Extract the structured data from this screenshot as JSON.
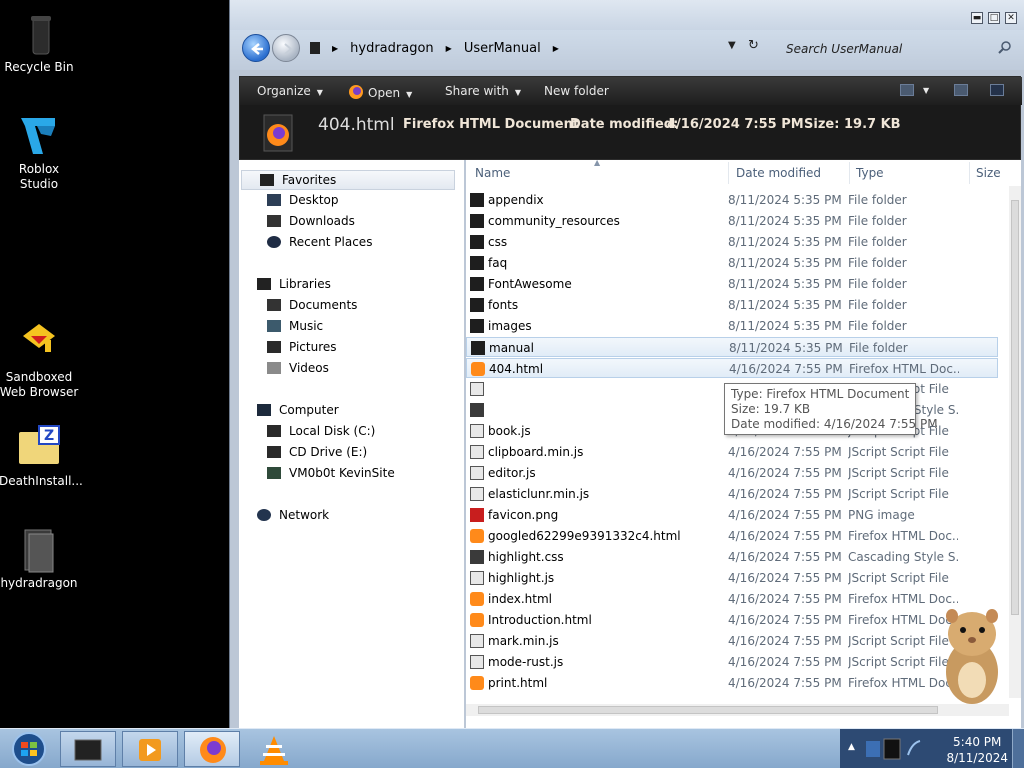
{
  "desktop": {
    "icons": [
      {
        "label": "Recycle Bin",
        "icon": "recycle-bin-icon"
      },
      {
        "label": "Roblox Studio",
        "icon": "roblox-studio-icon"
      },
      {
        "label": "Sandboxed Web Browser",
        "icon": "sandboxie-icon"
      },
      {
        "label": "DeathInstall...",
        "icon": "zip-folder-icon"
      },
      {
        "label": "hydradragon",
        "icon": "user-folder-icon"
      }
    ]
  },
  "window": {
    "controls": {
      "minimize": "▬",
      "maximize": "□",
      "close": "✕"
    },
    "breadcrumb": [
      "hydradragon",
      "UserManual"
    ],
    "search_placeholder": "Search UserManual",
    "toolbar": {
      "organize": "Organize",
      "open": "Open",
      "share_with": "Share with",
      "new_folder": "New folder"
    },
    "details": {
      "file_name": "404.html",
      "file_type": "Firefox HTML Document",
      "date_label": "Date modified:",
      "date_value": "4/16/2024 7:55 PM",
      "size_label": "Size:",
      "size_value": "19.7 KB"
    },
    "nav": {
      "favorites": "Favorites",
      "desktop": "Desktop",
      "downloads": "Downloads",
      "recent_places": "Recent Places",
      "libraries": "Libraries",
      "documents": "Documents",
      "music": "Music",
      "pictures": "Pictures",
      "videos": "Videos",
      "computer": "Computer",
      "local_disk": "Local Disk (C:)",
      "cd_drive": "CD Drive (E:)",
      "vm": "VM0b0t KevinSite",
      "network": "Network"
    },
    "columns": {
      "name": "Name",
      "date": "Date modified",
      "type": "Type",
      "size": "Size"
    },
    "files": [
      {
        "name": "appendix",
        "date": "8/11/2024 5:35 PM",
        "type": "File folder",
        "kind": "folder"
      },
      {
        "name": "community_resources",
        "date": "8/11/2024 5:35 PM",
        "type": "File folder",
        "kind": "folder"
      },
      {
        "name": "css",
        "date": "8/11/2024 5:35 PM",
        "type": "File folder",
        "kind": "folder"
      },
      {
        "name": "faq",
        "date": "8/11/2024 5:35 PM",
        "type": "File folder",
        "kind": "folder"
      },
      {
        "name": "FontAwesome",
        "date": "8/11/2024 5:35 PM",
        "type": "File folder",
        "kind": "folder"
      },
      {
        "name": "fonts",
        "date": "8/11/2024 5:35 PM",
        "type": "File folder",
        "kind": "folder"
      },
      {
        "name": "images",
        "date": "8/11/2024 5:35 PM",
        "type": "File folder",
        "kind": "folder"
      },
      {
        "name": "manual",
        "date": "8/11/2024 5:35 PM",
        "type": "File folder",
        "kind": "folder"
      },
      {
        "name": "404.html",
        "date": "4/16/2024 7:55 PM",
        "type": "Firefox HTML Doc...",
        "kind": "html"
      },
      {
        "name": "",
        "date": "4/16/2024 7:55 PM",
        "type": "JScript Script File",
        "kind": "js"
      },
      {
        "name": "",
        "date": "4/16/2024 7:55 PM",
        "type": "Cascading Style S...",
        "kind": "css"
      },
      {
        "name": "book.js",
        "date": "4/16/2024 7:55 PM",
        "type": "JScript Script File",
        "kind": "js"
      },
      {
        "name": "clipboard.min.js",
        "date": "4/16/2024 7:55 PM",
        "type": "JScript Script File",
        "kind": "js"
      },
      {
        "name": "editor.js",
        "date": "4/16/2024 7:55 PM",
        "type": "JScript Script File",
        "kind": "js"
      },
      {
        "name": "elasticlunr.min.js",
        "date": "4/16/2024 7:55 PM",
        "type": "JScript Script File",
        "kind": "js"
      },
      {
        "name": "favicon.png",
        "date": "4/16/2024 7:55 PM",
        "type": "PNG image",
        "kind": "png"
      },
      {
        "name": "googled62299e9391332c4.html",
        "date": "4/16/2024 7:55 PM",
        "type": "Firefox HTML Doc...",
        "kind": "html"
      },
      {
        "name": "highlight.css",
        "date": "4/16/2024 7:55 PM",
        "type": "Cascading Style S...",
        "kind": "css"
      },
      {
        "name": "highlight.js",
        "date": "4/16/2024 7:55 PM",
        "type": "JScript Script File",
        "kind": "js"
      },
      {
        "name": "index.html",
        "date": "4/16/2024 7:55 PM",
        "type": "Firefox HTML Doc...",
        "kind": "html"
      },
      {
        "name": "Introduction.html",
        "date": "4/16/2024 7:55 PM",
        "type": "Firefox HTML Doc...",
        "kind": "html"
      },
      {
        "name": "mark.min.js",
        "date": "4/16/2024 7:55 PM",
        "type": "JScript Script File",
        "kind": "js"
      },
      {
        "name": "mode-rust.js",
        "date": "4/16/2024 7:55 PM",
        "type": "JScript Script File",
        "kind": "js"
      },
      {
        "name": "print.html",
        "date": "4/16/2024 7:55 PM",
        "type": "Firefox HTML Doc...",
        "kind": "html"
      }
    ],
    "tooltip": {
      "type": "Type: Firefox HTML Document",
      "size": "Size: 19.7 KB",
      "date": "Date modified: 4/16/2024 7:55 PM"
    }
  },
  "taskbar": {
    "clock_time": "5:40 PM",
    "clock_date": "8/11/2024"
  }
}
